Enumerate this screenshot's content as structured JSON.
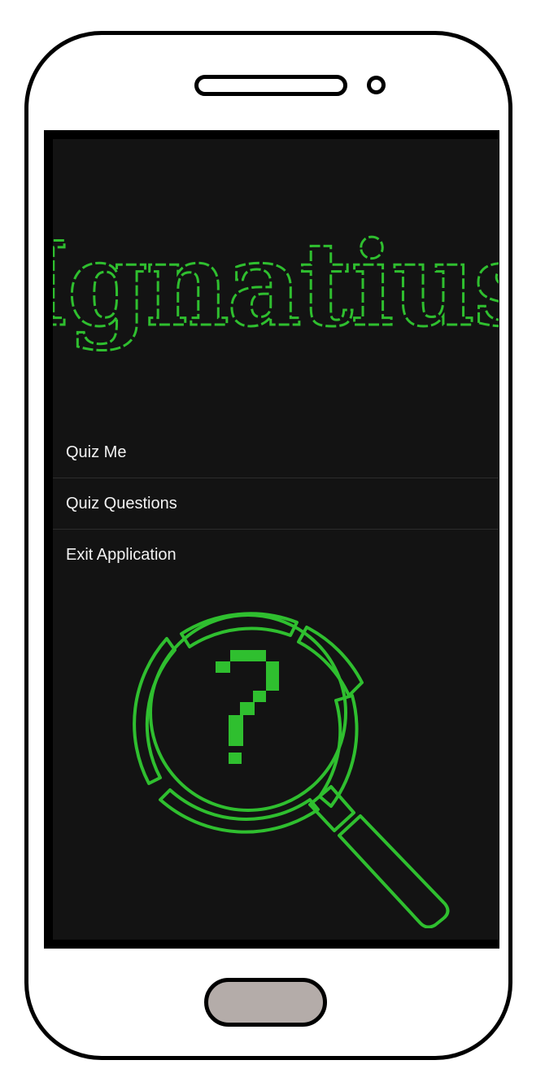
{
  "app": {
    "title": "Ignatius"
  },
  "menu": {
    "items": [
      {
        "label": "Quiz Me"
      },
      {
        "label": "Quiz Questions"
      },
      {
        "label": "Exit Application"
      }
    ]
  },
  "theme": {
    "background": "#131313",
    "accent": "#2fbf2f",
    "menu_text": "#f2f2f2"
  },
  "icons": {
    "emblem": "magnifying-glass-question-icon"
  }
}
